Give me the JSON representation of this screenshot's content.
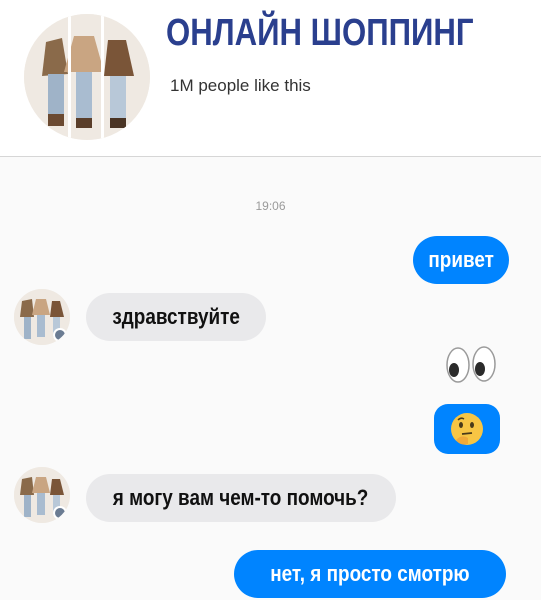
{
  "page": {
    "title": "ОНЛАЙН ШОППИНГ",
    "likes": "1M people like this"
  },
  "chat": {
    "timestamp": "19:06",
    "messages": [
      {
        "from": "me",
        "text": "привет"
      },
      {
        "from": "page",
        "text": "здравствуйте"
      },
      {
        "from": "me",
        "emoji": "eyes-emoji"
      },
      {
        "from": "me",
        "emoji": "thinking-face-emoji"
      },
      {
        "from": "page",
        "text": "я могу вам чем-то помочь?"
      },
      {
        "from": "me",
        "text": "нет, я просто смотрю"
      }
    ]
  },
  "colors": {
    "outgoing_bubble": "#0084ff",
    "incoming_bubble": "#e9e9eb",
    "title": "#2a3f8e"
  }
}
